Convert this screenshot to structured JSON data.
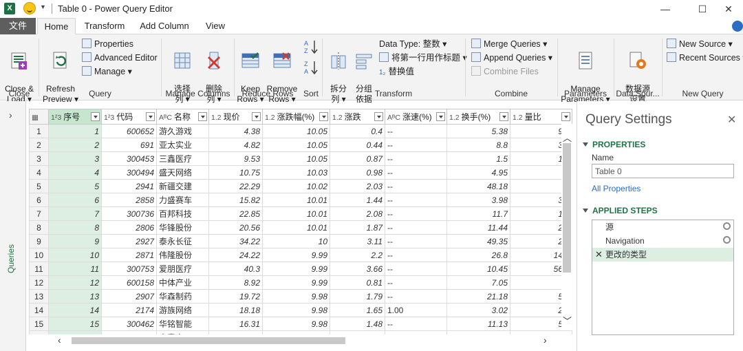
{
  "window": {
    "title": "Table 0 - Power Query Editor",
    "minimize": "—",
    "maximize": "☐",
    "close": "✕"
  },
  "tabs": [
    "文件",
    "Home",
    "Transform",
    "Add Column",
    "View"
  ],
  "ribbon": {
    "close_group": {
      "label": "Close",
      "close_load": "Close &\nLoad ▾"
    },
    "query_group": {
      "label": "Query",
      "refresh": "Refresh\nPreview ▾",
      "properties": "Properties",
      "advanced_editor": "Advanced Editor",
      "manage": "Manage ▾"
    },
    "manage_columns": {
      "label": "Manage Columns",
      "choose": "选择\n列 ▾",
      "remove": "删除\n列 ▾"
    },
    "reduce_rows": {
      "label": "Reduce Rows",
      "keep": "Keep\nRows ▾",
      "remove": "Remove\nRows ▾"
    },
    "sort": {
      "label": "Sort"
    },
    "transform": {
      "label": "Transform",
      "split": "拆分\n列 ▾",
      "group": "分组\n依据",
      "data_type": "Data Type: 整数 ▾",
      "first_row": "将第一行用作标题 ▾",
      "replace": "替换值"
    },
    "combine": {
      "label": "Combine",
      "merge": "Merge Queries ▾",
      "append": "Append Queries ▾",
      "combine_files": "Combine Files"
    },
    "parameters": {
      "label": "Parameters",
      "manage": "Manage\nParameters ▾"
    },
    "data_source": {
      "label": "Data Sour...",
      "settings": "数据源\n设置"
    },
    "new_query": {
      "label": "New Query",
      "new_source": "New Source ▾",
      "recent_sources": "Recent Sources ▾"
    }
  },
  "left_pane": {
    "label": "Queries",
    "expand": "›"
  },
  "grid": {
    "columns": [
      {
        "type": "1²3",
        "name": "序号"
      },
      {
        "type": "1²3",
        "name": "代码"
      },
      {
        "type": "AᴮC",
        "name": "名称"
      },
      {
        "type": "1.2",
        "name": "现价"
      },
      {
        "type": "1.2",
        "name": "涨跌幅(%)"
      },
      {
        "type": "1.2",
        "name": "涨跌"
      },
      {
        "type": "AᴮC",
        "name": "涨速(%)"
      },
      {
        "type": "1.2",
        "name": "换手(%)"
      },
      {
        "type": "1.2",
        "name": "量比"
      }
    ],
    "rows": [
      [
        "1",
        "1",
        "600652",
        "游久游戏",
        "4.38",
        "10.05",
        "0.4",
        "--",
        "5.38",
        "9.5"
      ],
      [
        "2",
        "2",
        "691",
        "亚太实业",
        "4.82",
        "10.05",
        "0.44",
        "--",
        "8.8",
        "3.1"
      ],
      [
        "3",
        "3",
        "300453",
        "三鑫医疗",
        "9.53",
        "10.05",
        "0.87",
        "--",
        "1.5",
        "1.5"
      ],
      [
        "4",
        "4",
        "300494",
        "盛天网络",
        "10.75",
        "10.03",
        "0.98",
        "--",
        "4.95",
        "2."
      ],
      [
        "5",
        "5",
        "2941",
        "新疆交建",
        "22.29",
        "10.02",
        "2.03",
        "--",
        "48.18",
        "1."
      ],
      [
        "6",
        "6",
        "2858",
        "力盛赛车",
        "15.82",
        "10.01",
        "1.44",
        "--",
        "3.98",
        "3.8"
      ],
      [
        "7",
        "7",
        "300736",
        "百邦科技",
        "22.85",
        "10.01",
        "2.08",
        "--",
        "11.7",
        "1.6"
      ],
      [
        "8",
        "8",
        "2806",
        "华锋股份",
        "20.56",
        "10.01",
        "1.87",
        "--",
        "11.44",
        "2.5"
      ],
      [
        "9",
        "9",
        "2927",
        "泰永长征",
        "34.22",
        "10",
        "3.11",
        "--",
        "49.35",
        "2.3"
      ],
      [
        "10",
        "10",
        "2871",
        "伟隆股份",
        "24.22",
        "9.99",
        "2.2",
        "--",
        "26.8",
        "14.9"
      ],
      [
        "11",
        "11",
        "300753",
        "爱朋医疗",
        "40.3",
        "9.99",
        "3.66",
        "--",
        "10.45",
        "56.8"
      ],
      [
        "12",
        "12",
        "600158",
        "中体产业",
        "8.92",
        "9.99",
        "0.81",
        "--",
        "7.05",
        "7."
      ],
      [
        "13",
        "13",
        "2907",
        "华森制药",
        "19.72",
        "9.98",
        "1.79",
        "--",
        "21.18",
        "5.3"
      ],
      [
        "14",
        "14",
        "2174",
        "游族网络",
        "18.18",
        "9.98",
        "1.65",
        "1.00",
        "3.02",
        "2.0"
      ],
      [
        "15",
        "15",
        "300462",
        "华铭智能",
        "16.31",
        "9.98",
        "1.48",
        "--",
        "11.13",
        "5.2"
      ],
      [
        "16",
        "16",
        "300052",
        "中青宝",
        "9.93",
        "9.96",
        "0.90",
        "--",
        "4.11",
        "7."
      ]
    ]
  },
  "settings": {
    "title": "Query Settings",
    "close": "✕",
    "properties_label": "PROPERTIES",
    "name_label": "Name",
    "name_value": "Table 0",
    "all_properties": "All Properties",
    "steps_label": "APPLIED STEPS",
    "steps": [
      {
        "name": "源",
        "gear": true,
        "active": false
      },
      {
        "name": "Navigation",
        "gear": true,
        "active": false
      },
      {
        "name": "更改的类型",
        "gear": false,
        "active": true
      }
    ]
  },
  "colors": {
    "accent_green": "#217346",
    "selected_col": "#dcefe2",
    "file_tab": "#5e5e5e"
  }
}
